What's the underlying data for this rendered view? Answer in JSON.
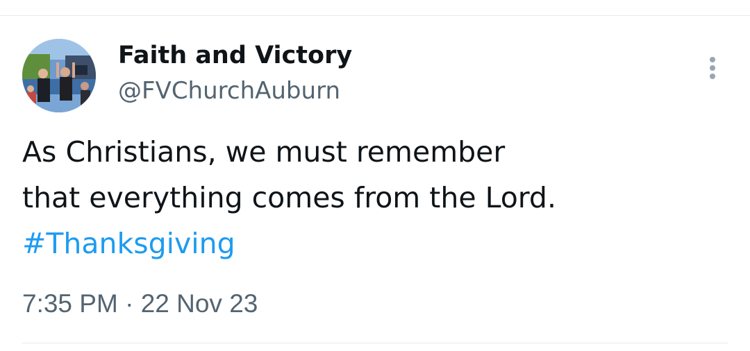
{
  "tweet": {
    "author": {
      "display_name": "Faith and Victory",
      "handle": "@FVChurchAuburn"
    },
    "text_lines": [
      "As Christians, we must remember",
      "that everything comes from the Lord."
    ],
    "hashtag": "#Thanksgiving",
    "timestamp": {
      "time": "7:35 PM",
      "separator": "·",
      "date": "22 Nov 23"
    },
    "more_icon": "vertical-ellipsis-icon",
    "colors": {
      "text_primary": "#0f1419",
      "text_secondary": "#536471",
      "link": "#1d9bf0",
      "divider": "#e6e8ea"
    }
  }
}
